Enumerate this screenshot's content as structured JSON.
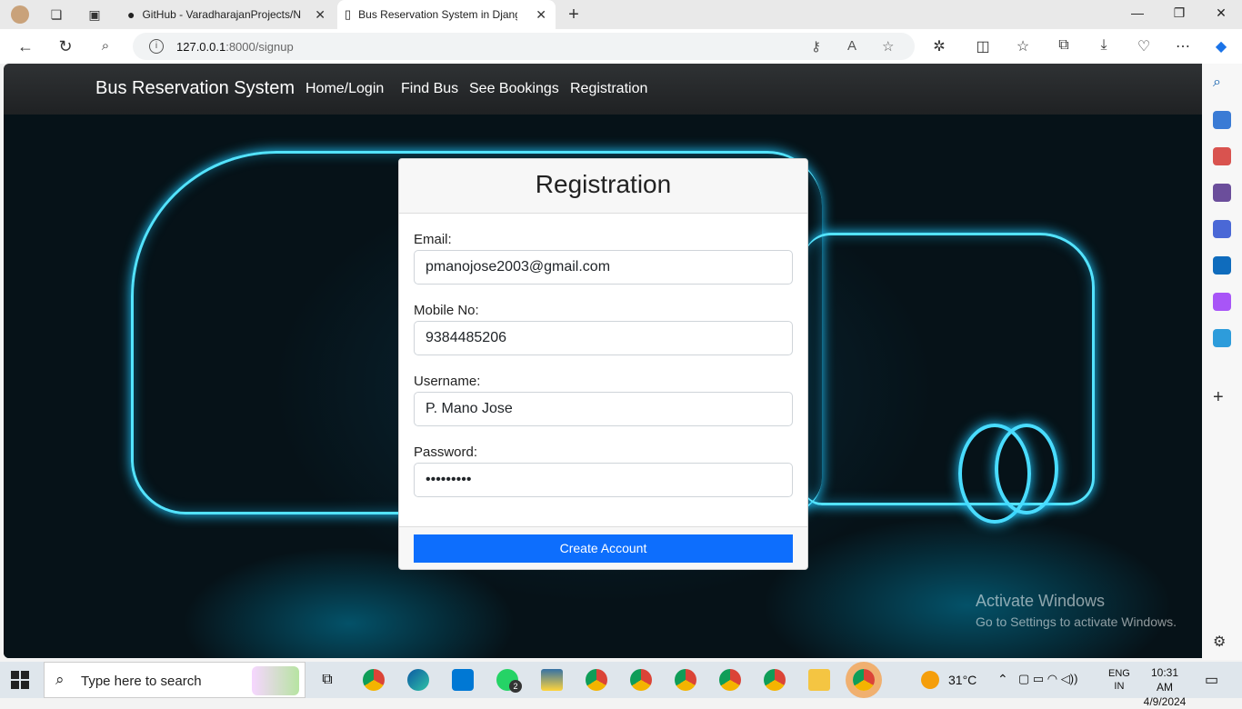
{
  "browser": {
    "tabs": [
      {
        "title": "GitHub - VaradharajanProjects/N",
        "icon": "github-icon"
      },
      {
        "title": "Bus Reservation System in Djang",
        "icon": "page-icon"
      }
    ],
    "url_host": "127.0.0.1",
    "url_path": ":8000/signup",
    "window_controls": {
      "minimize": "—",
      "maximize": "❐",
      "close": "✕"
    }
  },
  "navbar": {
    "brand": "Bus Reservation System",
    "links": [
      "Home/Login",
      "Find Bus",
      "See Bookings",
      "Registration"
    ]
  },
  "form": {
    "title": "Registration",
    "email_label": "Email:",
    "email_value": "pmanojose2003@gmail.com",
    "mobile_label": "Mobile No:",
    "mobile_value": "9384485206",
    "username_label": "Username:",
    "username_value": "P. Mano Jose",
    "password_label": "Password:",
    "password_value": "•••••••••",
    "submit_label": "Create Account"
  },
  "watermark": {
    "line1": "Activate Windows",
    "line2": "Go to Settings to activate Windows."
  },
  "taskbar": {
    "search_placeholder": "Type here to search",
    "temperature": "31°C",
    "language_top": "ENG",
    "language_bottom": "IN",
    "time": "10:31 AM",
    "date": "4/9/2024",
    "whatsapp_badge": "2"
  }
}
